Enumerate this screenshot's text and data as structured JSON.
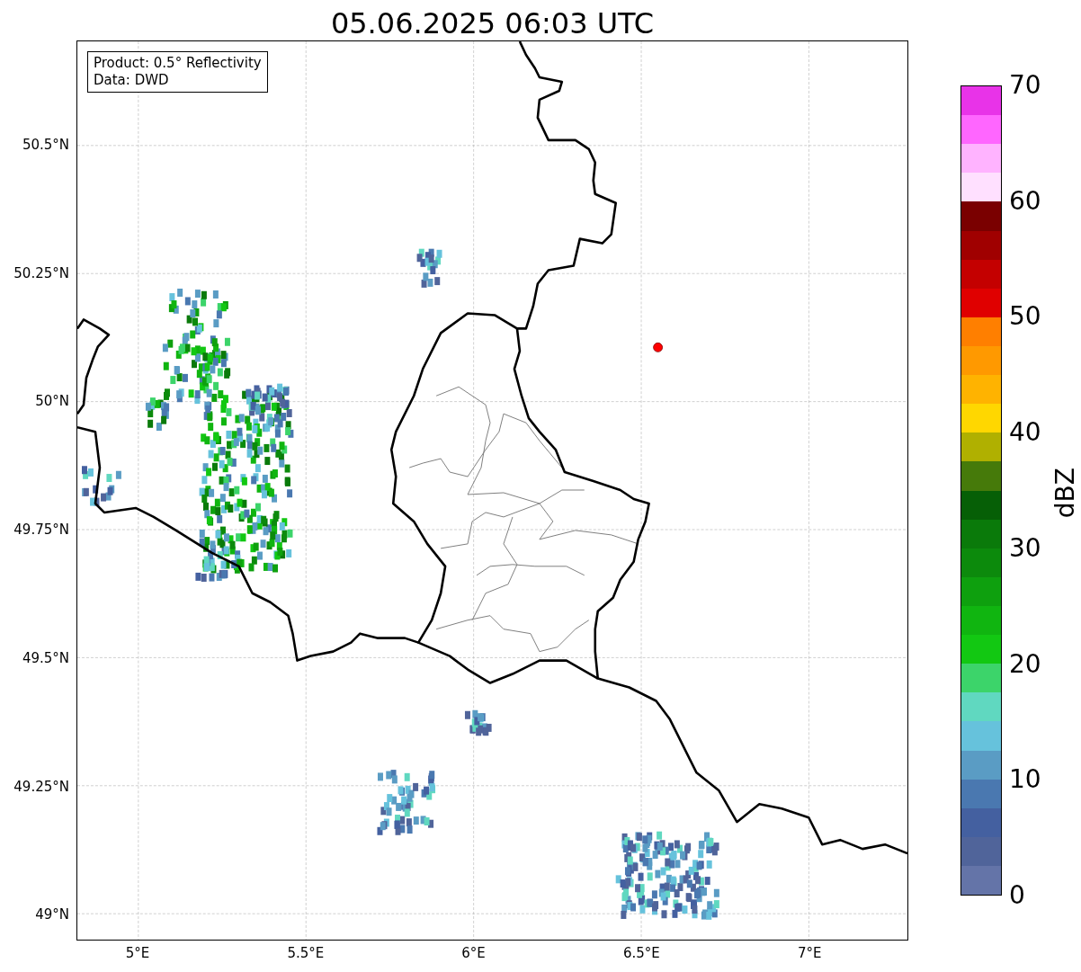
{
  "title": "05.06.2025 06:03 UTC",
  "info_box": {
    "lines": [
      "Product: 0.5° Reflectivity",
      "Data: DWD"
    ]
  },
  "map": {
    "xticks": [
      "5°E",
      "5.5°E",
      "6°E",
      "6.5°E",
      "7°E"
    ],
    "yticks": [
      "50.5°N",
      "50.25°N",
      "50°N",
      "49.75°N",
      "49.5°N",
      "49.25°N",
      "49°N"
    ]
  },
  "colorbar": {
    "label": "dBZ",
    "ticks": [
      "70",
      "60",
      "50",
      "40",
      "30",
      "20",
      "10",
      "0"
    ],
    "segments": [
      {
        "color": "#e833e8"
      },
      {
        "color": "#ff66ff"
      },
      {
        "color": "#ffb3ff"
      },
      {
        "color": "#ffe0ff"
      },
      {
        "color": "#7a0000"
      },
      {
        "color": "#a00000"
      },
      {
        "color": "#c40000"
      },
      {
        "color": "#e00000"
      },
      {
        "color": "#ff7f00"
      },
      {
        "color": "#ff9900"
      },
      {
        "color": "#ffb300"
      },
      {
        "color": "#ffd700"
      },
      {
        "color": "#b0b000"
      },
      {
        "color": "#467a0a"
      },
      {
        "color": "#065f06"
      },
      {
        "color": "#0a7a0a"
      },
      {
        "color": "#0c8a0c"
      },
      {
        "color": "#0ea00e"
      },
      {
        "color": "#10b510"
      },
      {
        "color": "#12c812"
      },
      {
        "color": "#3cd46a"
      },
      {
        "color": "#60d8c0"
      },
      {
        "color": "#66c2dc"
      },
      {
        "color": "#5a9cc4"
      },
      {
        "color": "#4a78b0"
      },
      {
        "color": "#4460a0"
      },
      {
        "color": "#50649a"
      },
      {
        "color": "#6474a8"
      }
    ]
  }
}
